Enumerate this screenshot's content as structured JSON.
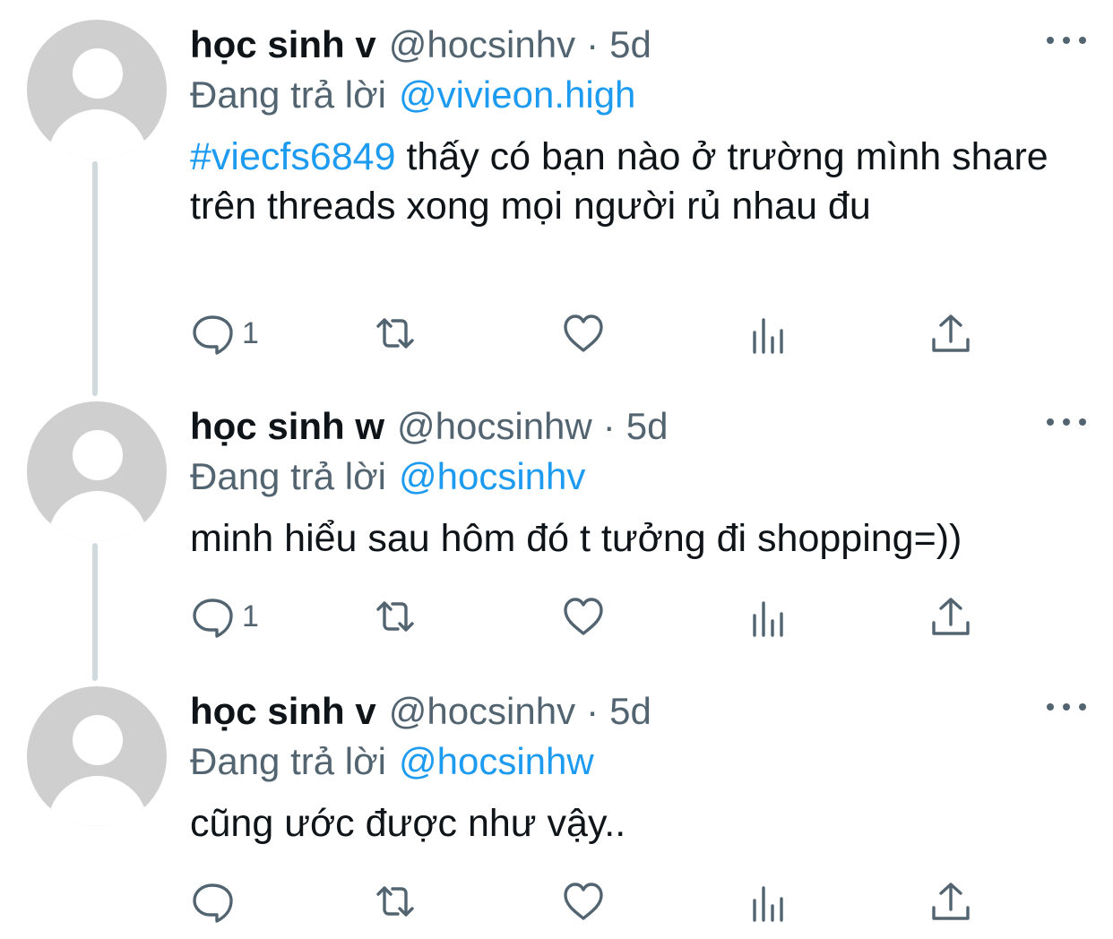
{
  "tweets": [
    {
      "display_name": "học sinh v",
      "handle": "@hocsinhv",
      "separator": "·",
      "time": "5d",
      "replying_to_label": "Đang trả lời",
      "replying_to": "@vivieon.high",
      "hashtag": "#viecfs6849",
      "text": " thấy có bạn nào ở trường mình share trên threads xong mọi người rủ nhau đu",
      "reply_count": "1",
      "icons": {
        "reply": "comment-icon",
        "retweet": "retweet-icon",
        "like": "heart-icon",
        "views": "views-icon",
        "share": "share-icon",
        "more": "more-icon",
        "avatar": "default-avatar-icon"
      }
    },
    {
      "display_name": "học sinh w",
      "handle": "@hocsinhw",
      "separator": "·",
      "time": "5d",
      "replying_to_label": "Đang trả lời",
      "replying_to": "@hocsinhv",
      "text": "minh hiểu sau hôm đó t tưởng đi shopping=))",
      "reply_count": "1"
    },
    {
      "display_name": "học sinh v",
      "handle": "@hocsinhv",
      "separator": "·",
      "time": "5d",
      "replying_to_label": "Đang trả lời",
      "replying_to": "@hocsinhw",
      "text": "cũng ước được như vậy..",
      "reply_count": ""
    }
  ],
  "colors": {
    "link": "#1d9bf0",
    "secondary_text": "#536471",
    "primary_text": "#0f1419",
    "avatar_bg": "#cfcfcf",
    "thread_line": "#cfd9de"
  }
}
